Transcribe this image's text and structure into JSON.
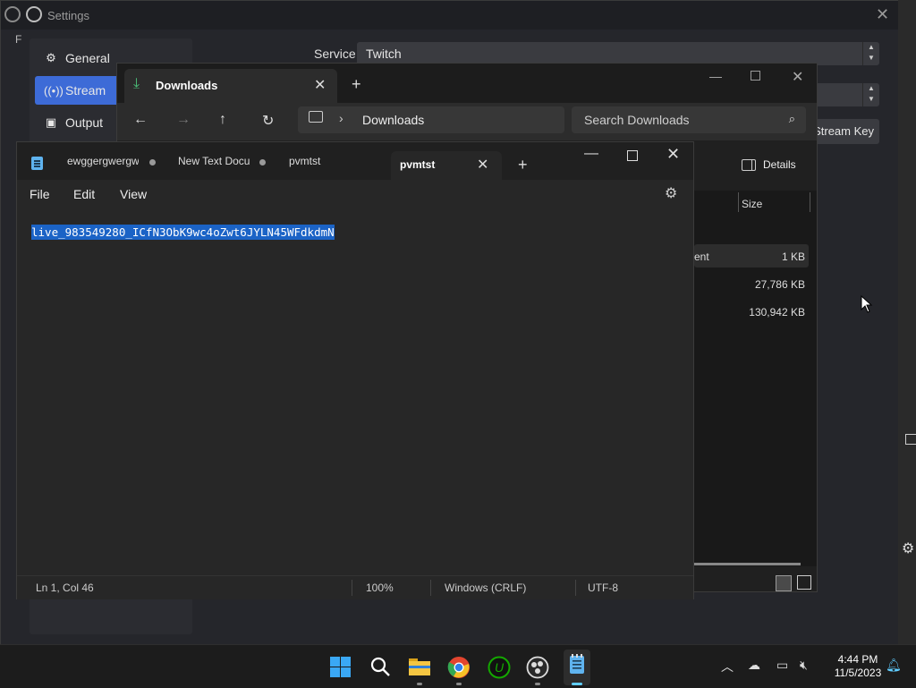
{
  "obs": {
    "title": "Settings",
    "left_letter": "F",
    "nav": [
      {
        "label": "General",
        "icon": "gear-icon"
      },
      {
        "label": "Stream",
        "icon": "antenna-icon"
      },
      {
        "label": "Output",
        "icon": "output-icon"
      }
    ],
    "service_label": "Service",
    "service_value": "Twitch",
    "stream_key_button": "Stream Key"
  },
  "explorer": {
    "tab_label": "Downloads",
    "address_location": "Downloads",
    "search_placeholder": "Search Downloads",
    "details_label": "Details",
    "column_size": "Size",
    "rows": [
      {
        "type": "ent",
        "size": "1 KB"
      },
      {
        "type": "",
        "size": "27,786 KB"
      },
      {
        "type": "",
        "size": "130,942 KB"
      }
    ]
  },
  "notepad": {
    "tabs": [
      {
        "label": "ewggergwergw",
        "unsaved": true
      },
      {
        "label": "New Text Docu",
        "unsaved": true
      },
      {
        "label": "pvmtst",
        "unsaved": false
      }
    ],
    "active_tab": "pvmtst",
    "menu": [
      "File",
      "Edit",
      "View"
    ],
    "content": "live_983549280_ICfN3ObK9wc4oZwt6JYLN45WFdkdmN",
    "status": {
      "position": "Ln 1, Col 46",
      "zoom": "100%",
      "line_ending": "Windows (CRLF)",
      "encoding": "UTF-8"
    }
  },
  "taskbar": {
    "time": "4:44 PM",
    "date": "11/5/2023",
    "apps": [
      "start-icon",
      "search-icon",
      "file-explorer-icon",
      "chrome-icon",
      "upwork-icon",
      "obs-icon",
      "notepad-icon"
    ]
  },
  "colors": {
    "accent": "#3d6bd7",
    "selection": "#1b63c6",
    "downloads_icon": "#4cc27a"
  }
}
